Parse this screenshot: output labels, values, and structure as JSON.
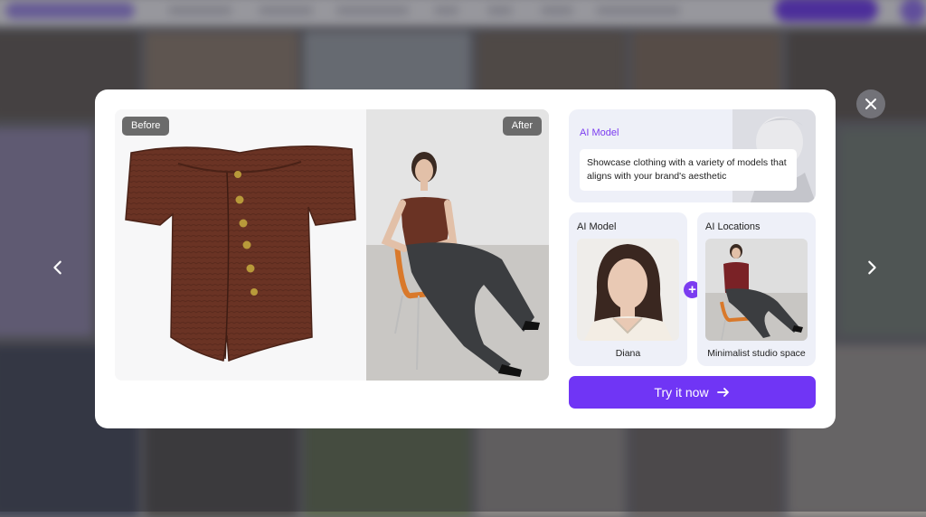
{
  "modal": {
    "before_label": "Before",
    "after_label": "After",
    "info_card": {
      "title": "AI Model",
      "description": "Showcase clothing with a variety of models that aligns with your brand's aesthetic"
    },
    "model_card": {
      "title": "AI Model",
      "caption": "Diana"
    },
    "location_card": {
      "title": "AI Locations",
      "caption": "Minimalist studio space"
    },
    "plus_symbol": "+",
    "cta": {
      "label": "Try it now",
      "icon": "arrow-right-icon"
    }
  },
  "controls": {
    "close_icon": "close-icon",
    "prev_icon": "chevron-left-icon",
    "next_icon": "chevron-right-icon"
  },
  "colors": {
    "accent": "#7035f5",
    "accent_text": "#7b3cf0",
    "card_bg": "#eef0f8",
    "garment": "#6a3324"
  }
}
